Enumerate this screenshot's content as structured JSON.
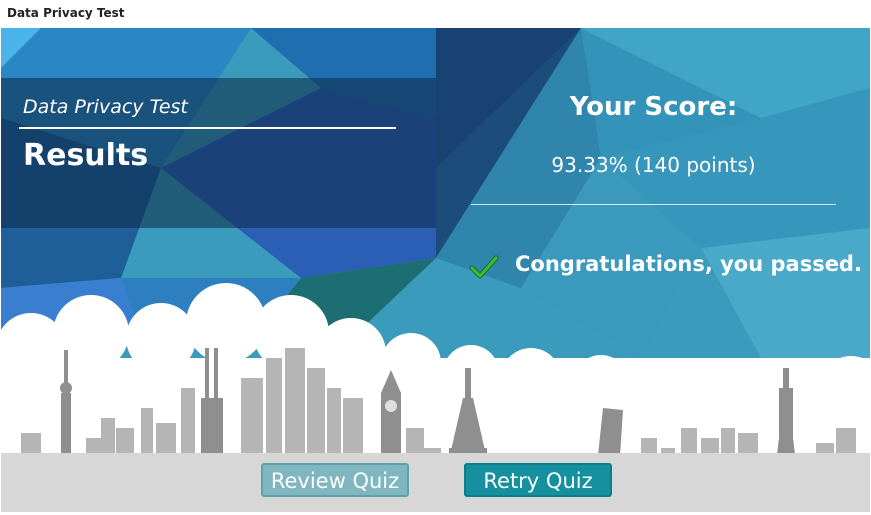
{
  "window": {
    "title": "Data Privacy Test"
  },
  "results": {
    "quiz_name": "Data Privacy Test",
    "heading": "Results",
    "score_heading": "Your Score:",
    "score_value": "93.33% (140 points)",
    "pass_message": "Congratulations, you passed.",
    "status_icon": "checkmark-icon"
  },
  "buttons": {
    "review_label": "Review Quiz",
    "retry_label": "Retry Quiz"
  },
  "colors": {
    "background_teal": "#3a9bbd",
    "review_button": "#7fb6bf",
    "retry_button": "#14909e",
    "check_green": "#2e9e2e",
    "skyline_gray": "#a8a8a8",
    "ground_gray": "#d7d7d7"
  }
}
